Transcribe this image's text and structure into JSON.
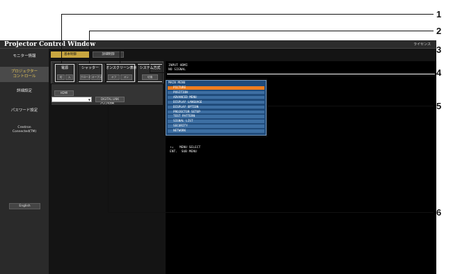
{
  "header": {
    "title": "Projector Control Window",
    "license": "ライセンス"
  },
  "sidebar": {
    "items": [
      {
        "label": "モニター情報"
      },
      {
        "label": "プロジェクター\nコントロール"
      },
      {
        "label": "詳細設定"
      },
      {
        "label": "パスワード設定"
      },
      {
        "label": "Crestron\nConnected(TM)"
      }
    ],
    "language": "English"
  },
  "tabs": {
    "basic": "基本制御",
    "detail": "詳細制御"
  },
  "controls": {
    "power": {
      "label": "電源",
      "off": "切",
      "on": "入"
    },
    "shutter": {
      "label": "シャッター",
      "close": "クローズ",
      "open": "オープン"
    },
    "osd": {
      "label": "オンスクリーン表示",
      "off": "オフ",
      "on": "オン"
    },
    "system": {
      "label": "システム方式",
      "switch": "切換"
    },
    "input": {
      "label": "入力切換",
      "hdmi": "HDMI",
      "digital_link": "DIGITAL LINK"
    }
  },
  "display": {
    "input_label": "INPUT HDMI",
    "signal": "NO SIGNAL",
    "menu_title": "MAIN MENU",
    "menu_items": [
      "PICTURE",
      "POSITION",
      "ADVANCED MENU",
      "DISPLAY LANGUAGE",
      "DISPLAY OPTION",
      "PROJECTOR SETUP",
      "TEST PATTERN",
      "SIGNAL LIST",
      "SECURITY",
      "NETWORK"
    ],
    "selected_index": 0,
    "help_line1": "↑↓   MENU SELECT",
    "help_line2": "ENT.  SUB MENU"
  },
  "callouts": [
    "1",
    "2",
    "3",
    "4",
    "5",
    "6"
  ]
}
